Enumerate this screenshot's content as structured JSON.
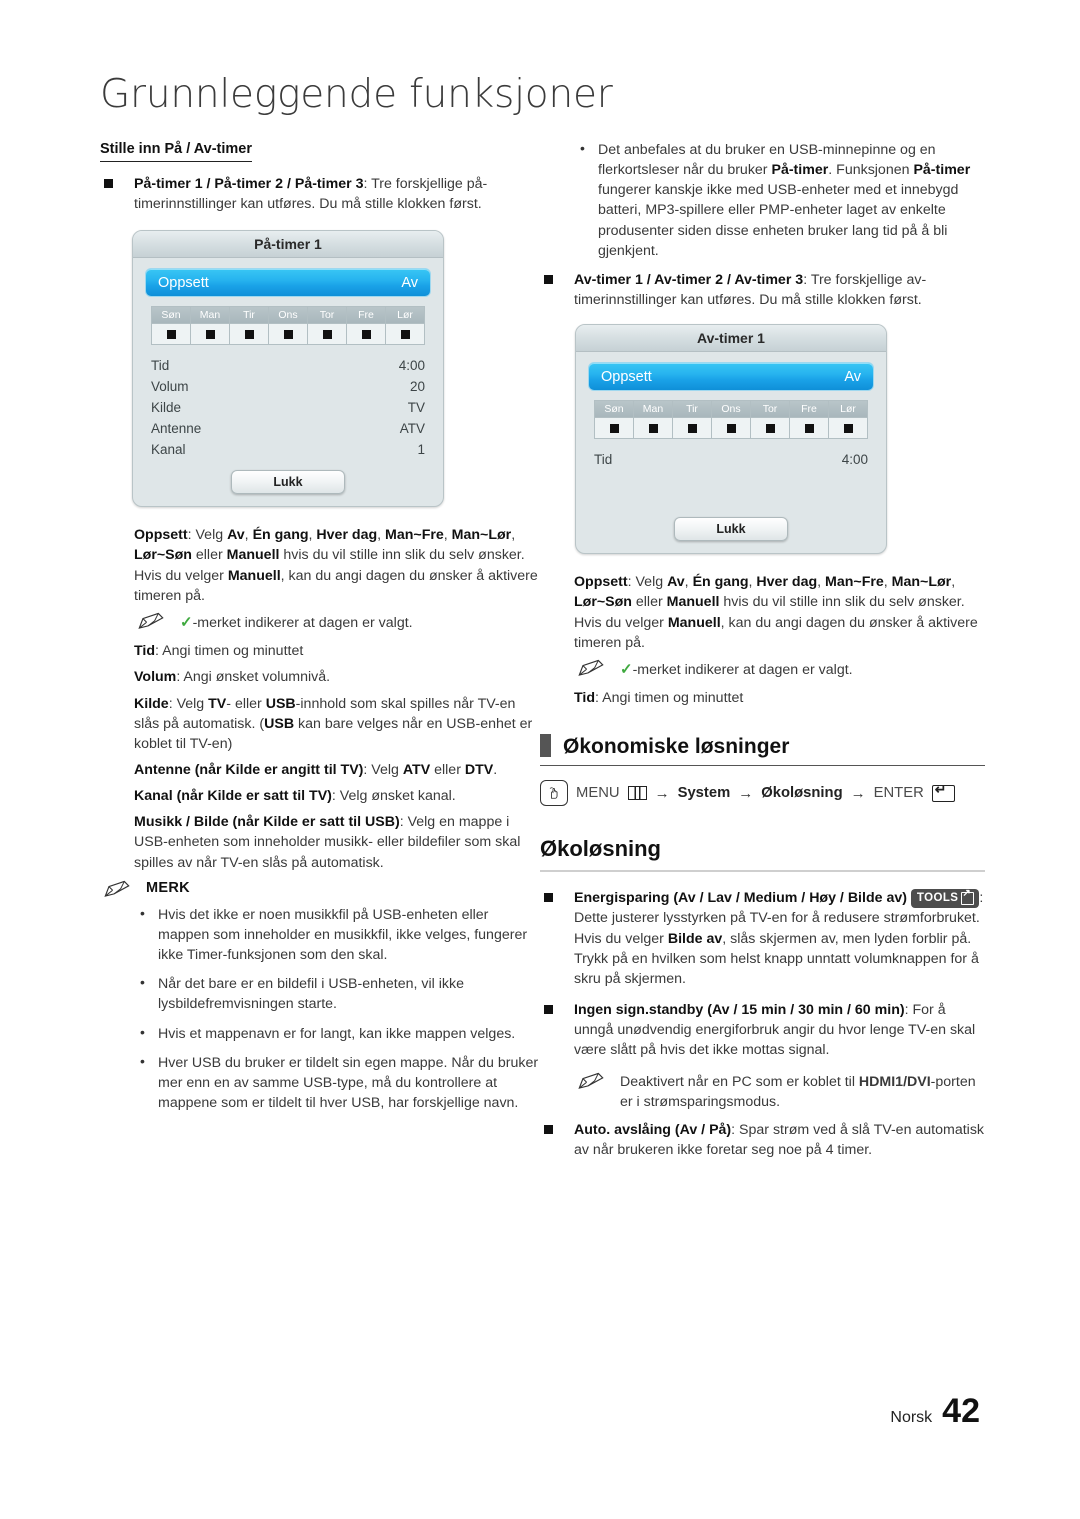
{
  "page": {
    "title": "Grunnleggende funksjoner",
    "footer_lang": "Norsk",
    "footer_page": "42"
  },
  "left": {
    "subhead": "Stille inn På / Av-timer",
    "timer_item": {
      "bold": "På-timer 1 / På-timer 2 / På-timer 3",
      "rest": ": Tre forskjellige på-timerinnstillinger kan utføres. Du må stille klokken først."
    },
    "osd": {
      "title": "På-timer 1",
      "setup_label": "Oppsett",
      "setup_value": "Av",
      "days": [
        "Søn",
        "Man",
        "Tir",
        "Ons",
        "Tor",
        "Fre",
        "Lør"
      ],
      "rows": [
        {
          "label": "Tid",
          "value": "4:00"
        },
        {
          "label": "Volum",
          "value": "20"
        },
        {
          "label": "Kilde",
          "value": "TV"
        },
        {
          "label": "Antenne",
          "value": "ATV"
        },
        {
          "label": "Kanal",
          "value": "1"
        }
      ],
      "close_button": "Lukk"
    },
    "oppsett_para": {
      "lead": "Oppsett",
      "t1": ": Velg ",
      "b1": "Av",
      "t2": ", ",
      "b2": "Én gang",
      "t3": ", ",
      "b3": "Hver dag",
      "t4": ", ",
      "b4": "Man~Fre",
      "t5": ", ",
      "b5": "Man~Lør",
      "t6": ", ",
      "b6": "Lør~Søn",
      "t7": " eller ",
      "b7": "Manuell",
      "t8": " hvis du vil stille inn slik du selv ønsker. Hvis du velger ",
      "b8": "Manuell",
      "t9": ", kan du angi dagen du ønsker å aktivere timeren på."
    },
    "check_note": "-merket indikerer at dagen er valgt.",
    "tid": {
      "bold": "Tid",
      "rest": ": Angi timen og minuttet"
    },
    "volum": {
      "bold": "Volum",
      "rest": ": Angi ønsket volumnivå."
    },
    "kilde": {
      "bold": "Kilde",
      "t1": ": Velg ",
      "b1": "TV",
      "t2": "- eller ",
      "b2": "USB",
      "t3": "-innhold som skal spilles når TV-en slås på automatisk. (",
      "b3": "USB",
      "t4": " kan bare velges når en USB-enhet er koblet til TV-en)"
    },
    "antenne": {
      "bold": "Antenne (når Kilde er angitt til TV)",
      "t1": ": Velg ",
      "b1": "ATV",
      "t2": " eller ",
      "b2": "DTV",
      "t3": "."
    },
    "kanal": {
      "bold": "Kanal (når Kilde er satt til TV)",
      "rest": ": Velg ønsket kanal."
    },
    "musikk": {
      "bold": "Musikk / Bilde (når Kilde er satt til USB)",
      "rest": ": Velg en mappe i USB-enheten som inneholder musikk- eller bildefiler som skal spilles av når TV-en slås på automatisk."
    },
    "merk_label": "MERK",
    "merk_bullets": [
      "Hvis det ikke er noen musikkfil på USB-enheten eller mappen som inneholder en musikkfil, ikke velges, fungerer ikke Timer-funksjonen som den skal.",
      "Når det bare er en bildefil i USB-enheten, vil ikke lysbildefremvisningen starte.",
      "Hvis et mappenavn er for langt, kan ikke mappen velges.",
      "Hver USB du bruker er tildelt sin egen mappe. Når du bruker mer enn en av samme USB-type, må du kontrollere at mappene som er tildelt til hver USB, har forskjellige navn."
    ]
  },
  "right": {
    "usb_note": {
      "t1": "Det anbefales at du bruker en USB-minnepinne og en flerkortsleser når du bruker ",
      "b1": "På-timer",
      "t2": ". Funksjonen ",
      "b2": "På-timer",
      "t3": " fungerer kanskje ikke med USB-enheter med et innebygd batteri, MP3-spillere eller PMP-enheter laget av enkelte produsenter siden disse enheten bruker lang tid på å bli gjenkjent."
    },
    "avtimer_item": {
      "bold": "Av-timer 1 / Av-timer 2 / Av-timer 3",
      "rest": ": Tre forskjellige av-timerinnstillinger kan utføres. Du må stille klokken først."
    },
    "osd": {
      "title": "Av-timer 1",
      "setup_label": "Oppsett",
      "setup_value": "Av",
      "days": [
        "Søn",
        "Man",
        "Tir",
        "Ons",
        "Tor",
        "Fre",
        "Lør"
      ],
      "rows": [
        {
          "label": "Tid",
          "value": "4:00"
        }
      ],
      "close_button": "Lukk"
    },
    "oppsett_para": {
      "lead": "Oppsett",
      "t1": ": Velg ",
      "b1": "Av",
      "t2": ", ",
      "b2": "Én gang",
      "t3": ", ",
      "b3": "Hver dag",
      "t4": ", ",
      "b4": "Man~Fre",
      "t5": ", ",
      "b5": "Man~Lør",
      "t6": ", ",
      "b6": "Lør~Søn",
      "t7": " eller ",
      "b7": "Manuell",
      "t8": " hvis du vil stille inn slik du selv ønsker. Hvis du velger ",
      "b8": "Manuell",
      "t9": ", kan du angi dagen du ønsker å aktivere timeren på."
    },
    "check_note": "-merket indikerer at dagen er valgt.",
    "tid": {
      "bold": "Tid",
      "rest": ": Angi timen og minuttet"
    },
    "section_heading": "Økonomiske løsninger",
    "menu_path": {
      "menu": "MENU",
      "arrow1": "→",
      "system": "System",
      "arrow2": "→",
      "oko": "Økoløsning",
      "arrow3": "→",
      "enter": "ENTER"
    },
    "sub_section_heading": "Økoløsning",
    "energisparing": {
      "bold": "Energisparing (Av / Lav / Medium / Høy / Bilde av)",
      "tools": "TOOLS",
      "t1": ": Dette justerer lysstyrken på TV-en for å redusere strømforbruket. Hvis du velger ",
      "b1": "Bilde av",
      "t2": ", slås skjermen av, men lyden forblir på. Trykk på en hvilken som helst knapp unntatt volumknappen for å skru på skjermen."
    },
    "standby": {
      "bold": "Ingen sign.standby (Av / 15 min / 30 min / 60 min)",
      "rest": ": For å unngå unødvendig energiforbruk angir du hvor lenge TV-en skal være slått på hvis det ikke mottas signal."
    },
    "standby_note": {
      "t1": "Deaktivert når en PC som er koblet til ",
      "b1": "HDMI1/DVI",
      "t2": "-porten er i strømsparingsmodus."
    },
    "auto": {
      "bold": "Auto. avslåing (Av / På)",
      "rest": ": Spar strøm ved å slå TV-en automatisk av når brukeren ikke foretar seg noe på 4 timer."
    }
  }
}
